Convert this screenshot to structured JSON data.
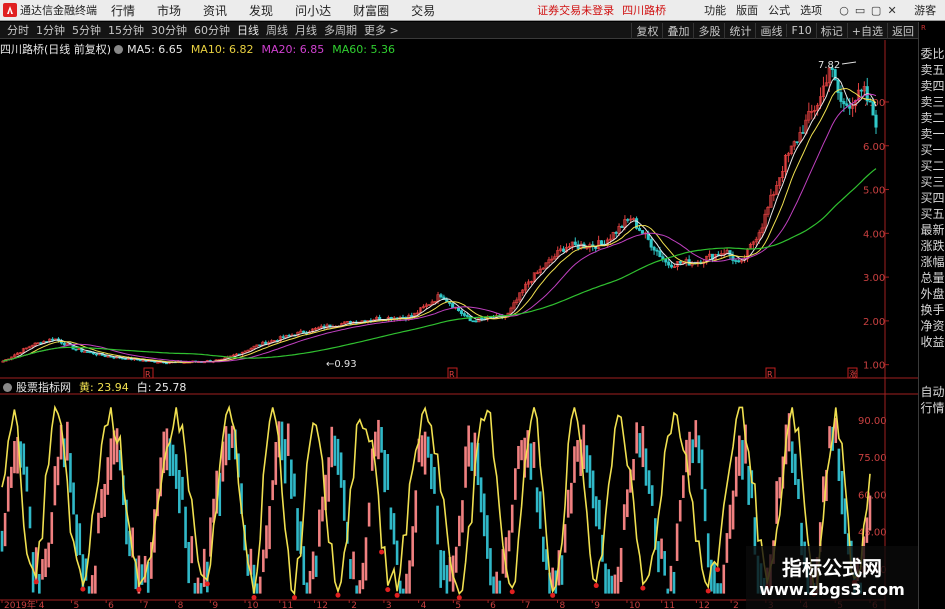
{
  "app": {
    "title": "通达信金融终端",
    "menu": [
      "行情",
      "市场",
      "资讯",
      "发现",
      "问小达",
      "财富圈",
      "交易"
    ],
    "login_status": "证券交易未登录",
    "stock_name": "四川路桥",
    "right_menu": [
      "功能",
      "版面",
      "公式",
      "选项"
    ],
    "window_buttons": [
      "○",
      "▭",
      "▢",
      "✕"
    ],
    "guest": "游客"
  },
  "periods": {
    "items": [
      "分时",
      "1分钟",
      "5分钟",
      "15分钟",
      "30分钟",
      "60分钟",
      "日线",
      "周线",
      "月线",
      "多周期"
    ],
    "active": "日线",
    "more": "更多 >"
  },
  "toolbar": [
    "复权",
    "叠加",
    "多股",
    "统计",
    "画线",
    "F10",
    "标记",
    "+自选",
    "返回"
  ],
  "right_tabs_top": [
    "委比",
    "卖五",
    "卖四",
    "卖三",
    "卖二",
    "卖一",
    "买一",
    "买二",
    "买三",
    "买四",
    "买五",
    "最新",
    "涨跌",
    "涨幅",
    "总量",
    "外盘",
    "换手",
    "净资",
    "收益"
  ],
  "right_tabs_bottom": [
    "自动",
    "行情"
  ],
  "right_label": "R",
  "price_panel": {
    "title": "四川路桥(日线 前复权)",
    "ma": [
      {
        "label": "MA5: 6.65",
        "color": "#e8e8e8"
      },
      {
        "label": "MA10: 6.82",
        "color": "#e8d040"
      },
      {
        "label": "MA20: 6.85",
        "color": "#d040d0"
      },
      {
        "label": "MA60: 5.36",
        "color": "#30d030"
      }
    ],
    "high_label": "7.82",
    "low_label": "0.93",
    "y_ticks": [
      "7.00",
      "6.00",
      "5.00",
      "4.00",
      "3.00",
      "2.00",
      "1.00"
    ],
    "markers": [
      "R",
      "R",
      "R",
      "涨"
    ]
  },
  "indicator_panel": {
    "title": "股票指标网",
    "yellow_label": "黄: 23.94",
    "white_label": "白: 25.78",
    "y_ticks": [
      "90.00",
      "75.00",
      "60.00",
      "45.00",
      "30.00"
    ]
  },
  "x_axis": [
    "2019年",
    "4",
    "5",
    "6",
    "7",
    "8",
    "9",
    "10",
    "11",
    "12",
    "2",
    "3",
    "4",
    "5",
    "6",
    "7",
    "8",
    "9",
    "10",
    "11",
    "12",
    "2",
    "3",
    "4",
    "5",
    "6"
  ],
  "colors": {
    "up": "#e04040",
    "down": "#30c8c8",
    "yellow": "#f0e050",
    "ma60": "#30c030",
    "ma20": "#c040c0",
    "axis": "#a02020",
    "pink": "#f08080",
    "cyan": "#30b8c8"
  },
  "watermark": {
    "title": "指标公式网",
    "url": "www.zbgs3.com"
  }
}
